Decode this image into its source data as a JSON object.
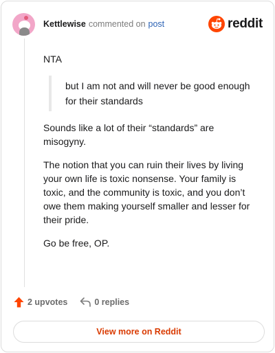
{
  "header": {
    "username": "Kettlewise",
    "verb": "commented on",
    "post_link": "post",
    "brand": "reddit"
  },
  "comment": {
    "paragraph_1": "NTA",
    "quote": "but I am not and will never be good enough for their standards",
    "paragraph_2": "Sounds like a lot of their “standards” are misogyny.",
    "paragraph_3": "The notion that you can ruin their lives by living your own life is toxic nonsense. Your family is toxic, and the community is toxic, and you don’t owe them making yourself smaller and lesser for their pride.",
    "paragraph_4": "Go be free, OP."
  },
  "actions": {
    "upvotes": "2 upvotes",
    "replies": "0 replies"
  },
  "footer": {
    "view_more": "View more on Reddit"
  },
  "colors": {
    "accent": "#d93a00",
    "upvote": "#ff4500",
    "link": "#2c63b5"
  },
  "icons": [
    "snoo-avatar-icon",
    "reddit-logo-icon",
    "upvote-arrow-icon",
    "reply-arrow-icon"
  ]
}
